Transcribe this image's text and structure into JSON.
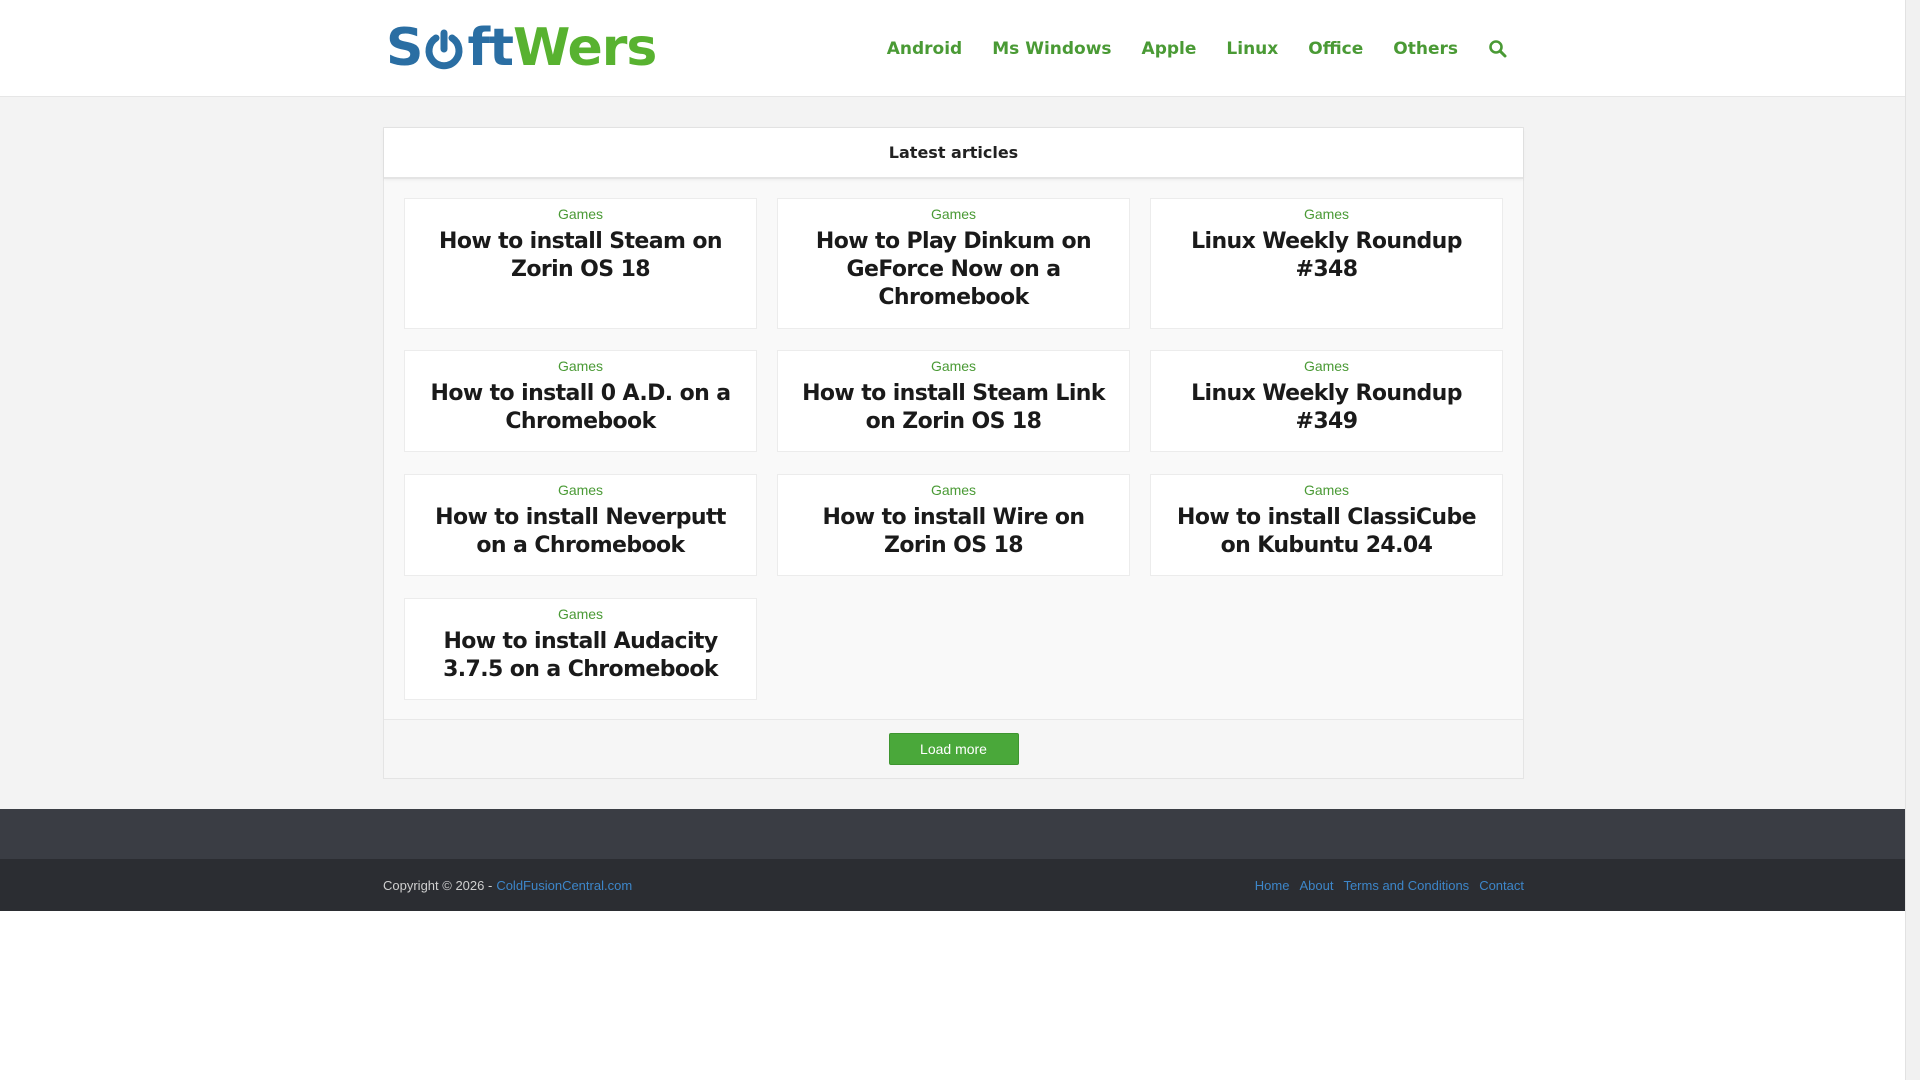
{
  "logo": {
    "part1": "S",
    "part2": "ft",
    "part3": "Wers"
  },
  "nav": {
    "items": [
      "Android",
      "Ms Windows",
      "Apple",
      "Linux",
      "Office",
      "Others"
    ]
  },
  "panel": {
    "heading": "Latest articles",
    "load_more_label": "Load more"
  },
  "articles": [
    {
      "category": "Games",
      "title": "How to install Steam on Zorin OS 18"
    },
    {
      "category": "Games",
      "title": "How to Play Dinkum on GeForce Now on a Chromebook"
    },
    {
      "category": "Games",
      "title": "Linux Weekly Roundup #348"
    },
    {
      "category": "Games",
      "title": "How to install 0 A.D. on a Chromebook"
    },
    {
      "category": "Games",
      "title": "How to install Steam Link on Zorin OS 18"
    },
    {
      "category": "Games",
      "title": "Linux Weekly Roundup #349"
    },
    {
      "category": "Games",
      "title": "How to install Neverputt on a Chromebook"
    },
    {
      "category": "Games",
      "title": "How to install Wire on Zorin OS 18"
    },
    {
      "category": "Games",
      "title": "How to install ClassiCube on Kubuntu 24.04"
    },
    {
      "category": "Games",
      "title": "How to install Audacity 3.7.5 on a Chromebook"
    }
  ],
  "footer": {
    "copyright": "Copyright © 2026 -",
    "site_link": "ColdFusionCentral.com",
    "links": [
      "Home",
      "About",
      "Terms and Conditions",
      "Contact"
    ]
  },
  "colors": {
    "brand_green": "#4a9a35",
    "logo_blue": "#2a6ea3",
    "link_blue": "#3d86c9",
    "footer_dark": "#2b2d32"
  },
  "icons": {
    "logo_power": "power-icon",
    "search": "search-icon"
  }
}
